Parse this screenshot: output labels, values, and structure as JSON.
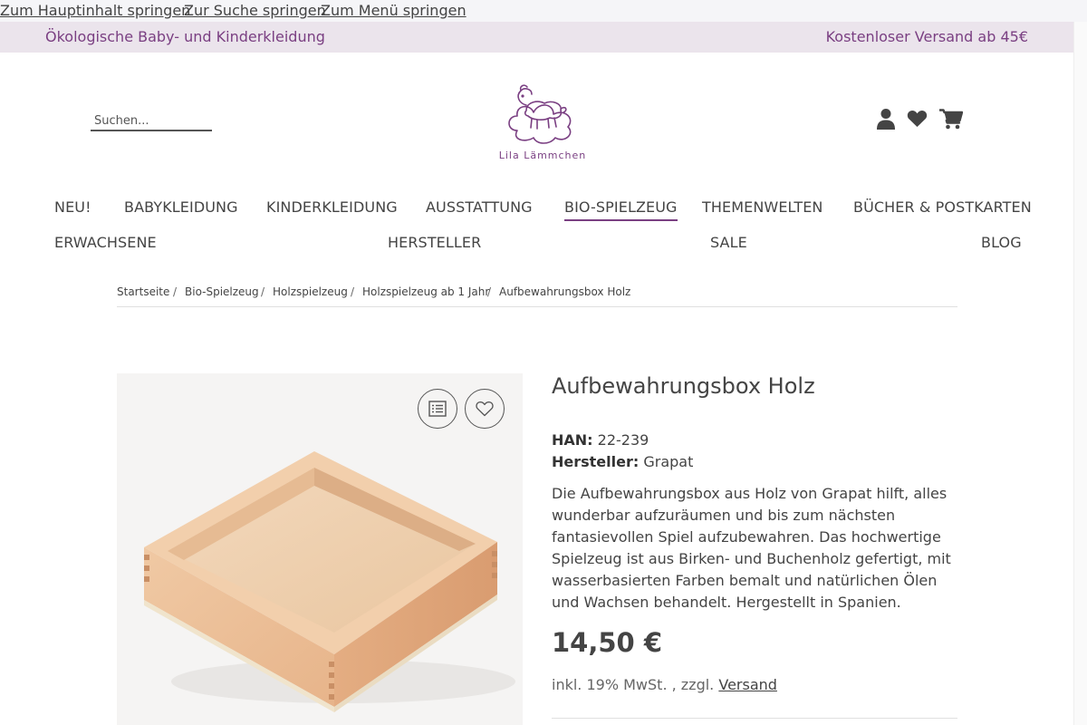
{
  "skip_links": [
    "Zum Hauptinhalt springen",
    "Zur Suche springen",
    "Zum Menü springen"
  ],
  "topbar": {
    "left_text": "Ökologische Baby- und Kinderkleidung",
    "right_text": "Kostenloser Versand ab 45€",
    "background": "#ebe4ec",
    "text_color": "#7a3f82"
  },
  "search": {
    "placeholder": "Suchen..."
  },
  "logo": {
    "text": "Lila Lämmchen",
    "color": "#7a3f82"
  },
  "header_icons": [
    "user-icon",
    "heart-icon",
    "cart-icon"
  ],
  "nav": {
    "row1": [
      "NEU!",
      "BABYKLEIDUNG",
      "KINDERKLEIDUNG",
      "AUSSTATTUNG",
      "BIO-SPIELZEUG",
      "THEMENWELTEN",
      "BÜCHER & POSTKARTEN"
    ],
    "row2": [
      "ERWACHSENE",
      "HERSTELLER",
      "SALE",
      "BLOG"
    ],
    "active": "BIO-SPIELZEUG"
  },
  "breadcrumb": [
    "Startseite",
    "Bio-Spielzeug",
    "Holzspielzeug",
    "Holzspielzeug ab 1 Jahr",
    "Aufbewahrungsbox Holz"
  ],
  "breadcrumb_separator": "/",
  "product": {
    "title": "Aufbewahrungsbox Holz",
    "han_label": "HAN:",
    "han_value": "22-239",
    "manufacturer_label": "Hersteller:",
    "manufacturer_value": "Grapat",
    "description": "Die Aufbewahrungsbox aus Holz von Grapat hilft, alles wunderbar aufzuräumen und bis zum nächsten fantasievollen Spiel aufzubewahren. Das hochwertige Spielzeug ist aus Birken- und Buchenholz gefertigt, mit wasserbasierten Farben bemalt und natürlichen Ölen und Wachsen behandelt. Hergestellt in Spanien.",
    "price": "14,50 €",
    "tax_text": "inkl. 19% MwSt. , zzgl.",
    "shipping_link": "Versand"
  },
  "gallery_buttons": [
    "compare-list-icon",
    "wishlist-heart-icon"
  ],
  "colors": {
    "accent": "#7a3f82",
    "text": "#444444"
  }
}
